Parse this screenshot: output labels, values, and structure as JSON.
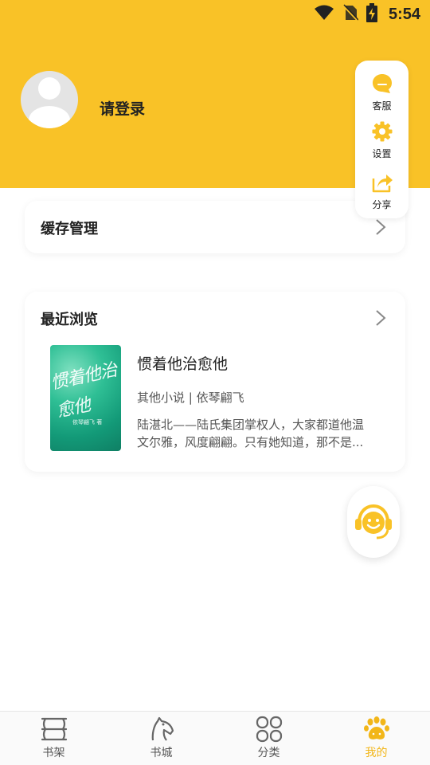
{
  "status_bar": {
    "time": "5:54",
    "icons": [
      "wifi-icon",
      "no-sim-icon",
      "battery-charging-icon"
    ]
  },
  "header": {
    "login_label": "请登录",
    "avatar_icon": "avatar-placeholder-icon"
  },
  "quick_menu": [
    {
      "label": "客服",
      "icon": "chat-bubble-icon"
    },
    {
      "label": "设置",
      "icon": "gear-icon"
    },
    {
      "label": "分享",
      "icon": "share-icon"
    }
  ],
  "cache_card": {
    "title": "缓存管理"
  },
  "recent_card": {
    "title": "最近浏览",
    "book": {
      "title": "惯着他治愈他",
      "meta": "其他小说 | 依琴翩飞",
      "desc_line1": "陆湛北——陆氏集团掌权人，大家都道他温",
      "desc_line2": "文尔雅，风度翩翩。只有她知道，那不是...",
      "cover_text": "惯着他治愈他",
      "cover_author": "依琴翩飞 著"
    }
  },
  "bottom_nav": [
    {
      "label": "书架",
      "icon": "bookshelf-icon",
      "active": false
    },
    {
      "label": "书城",
      "icon": "knight-chess-icon",
      "active": false
    },
    {
      "label": "分类",
      "icon": "category-grid-icon",
      "active": false
    },
    {
      "label": "我的",
      "icon": "paw-icon",
      "active": true
    }
  ],
  "colors": {
    "brand_yellow": "#f9c227",
    "accent_yellow": "#f2b619"
  }
}
